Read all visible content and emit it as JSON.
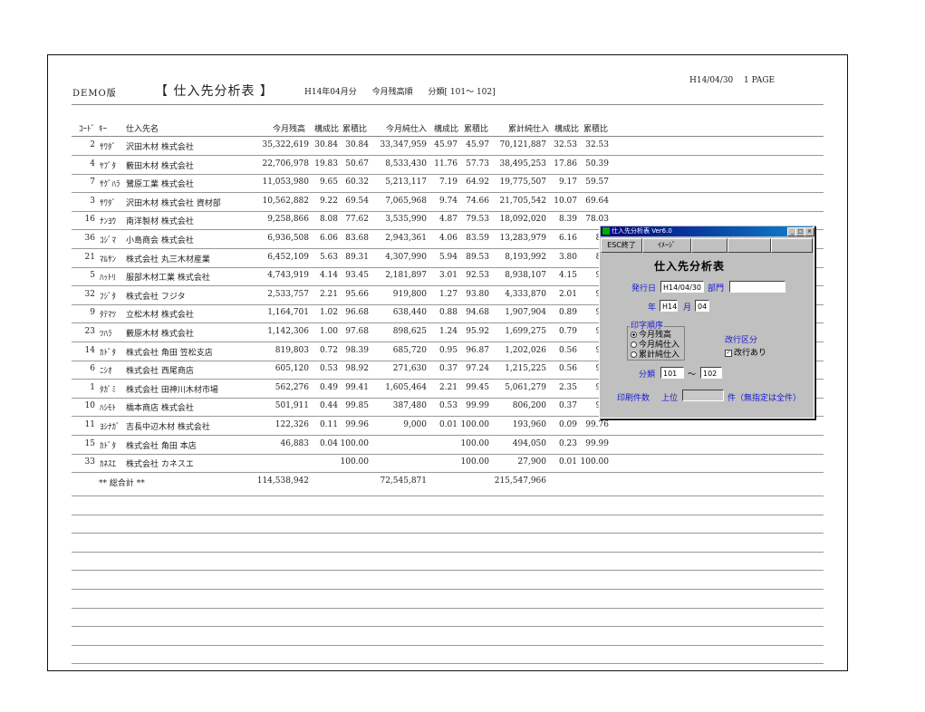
{
  "header": {
    "demo": "DEMO版",
    "title": "【 仕入先分析表 】",
    "month": "H14年04月分",
    "basis": "今月残高順",
    "category": "分類[ 101～ 102]",
    "date": "H14/04/30",
    "page": "1 PAGE"
  },
  "columns": {
    "code": "ｺｰﾄﾞ",
    "key": "ｷｰ",
    "name": "仕入先名",
    "balance": "今月残高",
    "ratio1": "構成比",
    "cum1": "累積比",
    "purchase": "今月純仕入",
    "ratio2": "構成比",
    "cum2": "累積比",
    "total": "累計純仕入",
    "ratio3": "構成比",
    "cum3": "累積比"
  },
  "rows": [
    {
      "code": "2",
      "key": "ｻﾜﾀﾞ",
      "name": "沢田木材 株式会社",
      "bal": "35,322,619",
      "r1": "30.84",
      "c1": "30.84",
      "pur": "33,347,959",
      "r2": "45.97",
      "c2": "45.97",
      "tot": "70,121,887",
      "r3": "32.53",
      "c3": "32.53"
    },
    {
      "code": "4",
      "key": "ﾔﾌﾞﾀ",
      "name": "藪田木材 株式会社",
      "bal": "22,706,978",
      "r1": "19.83",
      "c1": "50.67",
      "pur": "8,533,430",
      "r2": "11.76",
      "c2": "57.73",
      "tot": "38,495,253",
      "r3": "17.86",
      "c3": "50.39"
    },
    {
      "code": "7",
      "key": "ｻｸﾞﾊﾗ",
      "name": "鷺原工業 株式会社",
      "bal": "11,053,980",
      "r1": "9.65",
      "c1": "60.32",
      "pur": "5,213,117",
      "r2": "7.19",
      "c2": "64.92",
      "tot": "19,775,507",
      "r3": "9.17",
      "c3": "59.57"
    },
    {
      "code": "3",
      "key": "ｻﾜﾀﾞ",
      "name": "沢田木材 株式会社 資材部",
      "bal": "10,562,882",
      "r1": "9.22",
      "c1": "69.54",
      "pur": "7,065,968",
      "r2": "9.74",
      "c2": "74.66",
      "tot": "21,705,542",
      "r3": "10.07",
      "c3": "69.64"
    },
    {
      "code": "16",
      "key": "ﾅﾝﾖｳ",
      "name": "南洋製材 株式会社",
      "bal": "9,258,866",
      "r1": "8.08",
      "c1": "77.62",
      "pur": "3,535,990",
      "r2": "4.87",
      "c2": "79.53",
      "tot": "18,092,020",
      "r3": "8.39",
      "c3": "78.03"
    },
    {
      "code": "36",
      "key": "ｺｼﾞﾏ",
      "name": "小島商会 株式会社",
      "bal": "6,936,508",
      "r1": "6.06",
      "c1": "83.68",
      "pur": "2,943,361",
      "r2": "4.06",
      "c2": "83.59",
      "tot": "13,283,979",
      "r3": "6.16",
      "c3": "84."
    },
    {
      "code": "21",
      "key": "ﾏﾙｻﾝ",
      "name": "株式会社 丸三木材産業",
      "bal": "6,452,109",
      "r1": "5.63",
      "c1": "89.31",
      "pur": "4,307,990",
      "r2": "5.94",
      "c2": "89.53",
      "tot": "8,193,992",
      "r3": "3.80",
      "c3": "87."
    },
    {
      "code": "5",
      "key": "ﾊｯﾄﾘ",
      "name": "服部木材工業 株式会社",
      "bal": "4,743,919",
      "r1": "4.14",
      "c1": "93.45",
      "pur": "2,181,897",
      "r2": "3.01",
      "c2": "92.53",
      "tot": "8,938,107",
      "r3": "4.15",
      "c3": "92."
    },
    {
      "code": "32",
      "key": "ﾌｼﾞﾀ",
      "name": "株式会社 フジタ",
      "bal": "2,533,757",
      "r1": "2.21",
      "c1": "95.66",
      "pur": "919,800",
      "r2": "1.27",
      "c2": "93.80",
      "tot": "4,333,870",
      "r3": "2.01",
      "c3": "94."
    },
    {
      "code": "9",
      "key": "ﾀﾃﾏﾂ",
      "name": "立松木材 株式会社",
      "bal": "1,164,701",
      "r1": "1.02",
      "c1": "96.68",
      "pur": "638,440",
      "r2": "0.88",
      "c2": "94.68",
      "tot": "1,907,904",
      "r3": "0.89",
      "c3": "95."
    },
    {
      "code": "23",
      "key": "ﾂﾊﾗ",
      "name": "藪原木材 株式会社",
      "bal": "1,142,306",
      "r1": "1.00",
      "c1": "97.68",
      "pur": "898,625",
      "r2": "1.24",
      "c2": "95.92",
      "tot": "1,699,275",
      "r3": "0.79",
      "c3": "96."
    },
    {
      "code": "14",
      "key": "ｶﾄﾞﾀ",
      "name": "株式会社 角田 笠松支店",
      "bal": "819,803",
      "r1": "0.72",
      "c1": "98.39",
      "pur": "685,720",
      "r2": "0.95",
      "c2": "96.87",
      "tot": "1,202,026",
      "r3": "0.56",
      "c3": "96."
    },
    {
      "code": "6",
      "key": "ﾆｼｵ",
      "name": "株式会社 西尾商店",
      "bal": "605,120",
      "r1": "0.53",
      "c1": "98.92",
      "pur": "271,630",
      "r2": "0.37",
      "c2": "97.24",
      "tot": "1,215,225",
      "r3": "0.56",
      "c3": "96."
    },
    {
      "code": "1",
      "key": "ﾀｶﾞﾐ",
      "name": "株式会社 田神川木材市場",
      "bal": "562,276",
      "r1": "0.49",
      "c1": "99.41",
      "pur": "1,605,464",
      "r2": "2.21",
      "c2": "99.45",
      "tot": "5,061,279",
      "r3": "2.35",
      "c3": "99."
    },
    {
      "code": "10",
      "key": "ﾊｼﾓﾄ",
      "name": "橋本商店 株式会社",
      "bal": "501,911",
      "r1": "0.44",
      "c1": "99.85",
      "pur": "387,480",
      "r2": "0.53",
      "c2": "99.99",
      "tot": "806,200",
      "r3": "0.37",
      "c3": "99."
    },
    {
      "code": "11",
      "key": "ﾖｼﾅｶﾞ",
      "name": "吉長中辺木材 株式会社",
      "bal": "122,326",
      "r1": "0.11",
      "c1": "99.96",
      "pur": "9,000",
      "r2": "0.01",
      "c2": "100.00",
      "tot": "193,960",
      "r3": "0.09",
      "c3": "99.76"
    },
    {
      "code": "15",
      "key": "ｶﾄﾞﾀ",
      "name": "株式会社 角田 本店",
      "bal": "46,883",
      "r1": "0.04",
      "c1": "100.00",
      "pur": "",
      "r2": "",
      "c2": "100.00",
      "tot": "494,050",
      "r3": "0.23",
      "c3": "99.99"
    },
    {
      "code": "33",
      "key": "ｶﾈｽｴ",
      "name": "株式会社 カネスエ",
      "bal": "",
      "r1": "",
      "c1": "100.00",
      "pur": "",
      "r2": "",
      "c2": "100.00",
      "tot": "27,900",
      "r3": "0.01",
      "c3": "100.00"
    }
  ],
  "totals": {
    "label": "** 総合計 **",
    "bal": "114,538,942",
    "pur": "72,545,871",
    "tot": "215,547,966"
  },
  "dialog": {
    "title": "仕入先分析表 Ver6.0",
    "esc_button": "ESC終了",
    "image_button": "ｲﾒｰｼﾞ",
    "heading": "仕入先分析表",
    "issue_date_label": "発行日",
    "issue_date_value": "H14/04/30",
    "dept_label": "部門",
    "dept_value": "",
    "year_label": "年",
    "year_value": "H14",
    "month_label": "月",
    "month_value": "04",
    "print_order_label": "印字順序",
    "order_options": [
      "今月残高",
      "今月純仕入",
      "累計純仕入"
    ],
    "order_selected": 0,
    "page_break_label": "改行区分",
    "page_break_option": "改行あり",
    "page_break_checked": true,
    "category_label": "分類",
    "category_from": "101",
    "category_sep": "～",
    "category_to": "102",
    "print_count_label": "印刷件数",
    "top_label": "上位",
    "top_value": "",
    "count_note": "件（無指定は全件）",
    "minimize": "_",
    "maximize": "□",
    "close": "×"
  }
}
